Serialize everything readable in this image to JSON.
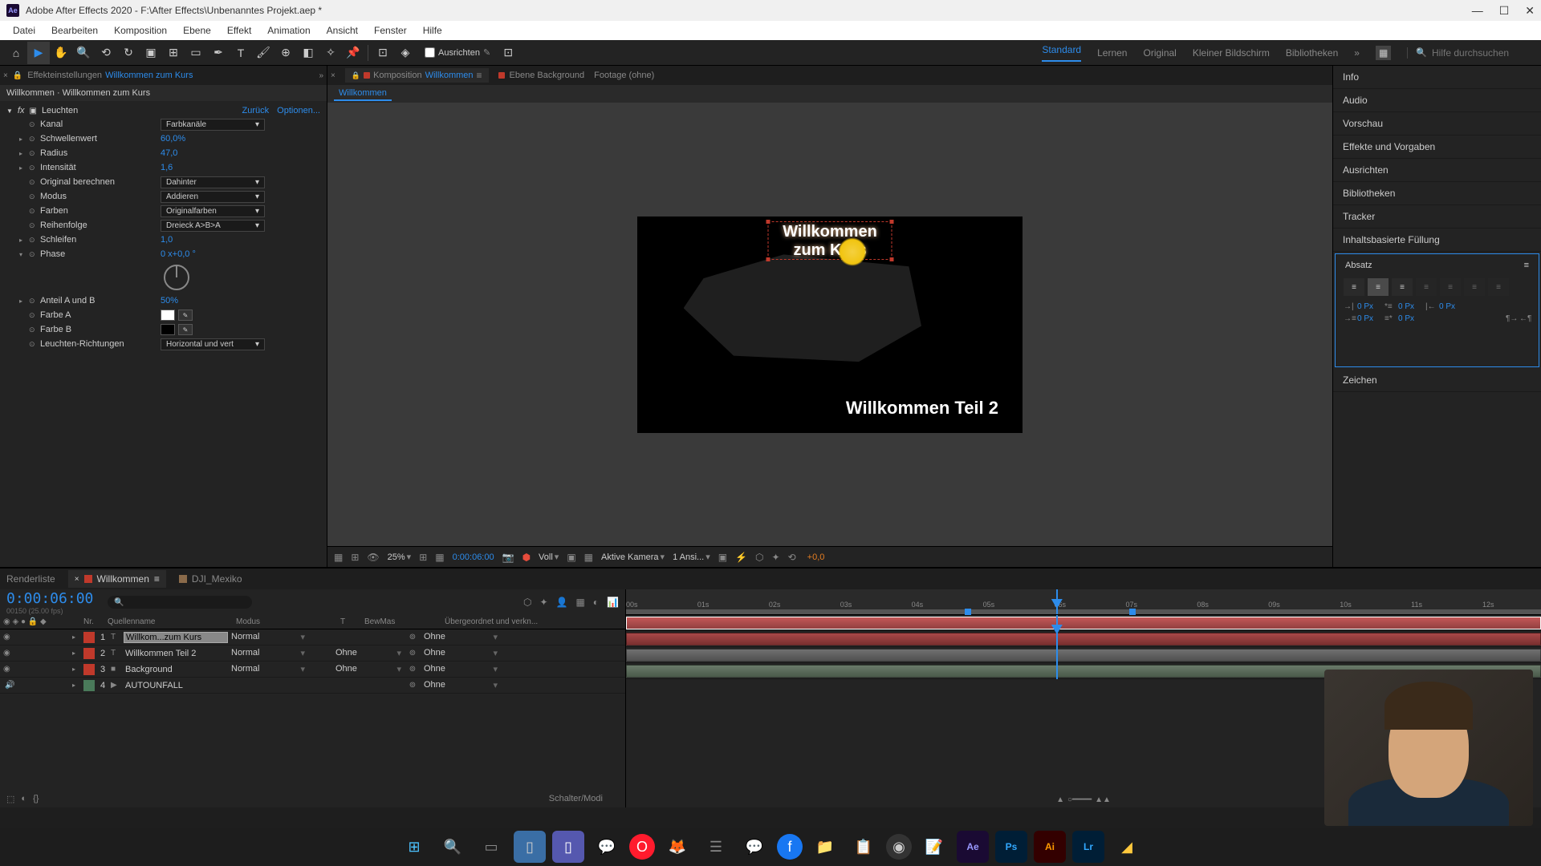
{
  "titlebar": {
    "app": "Ae",
    "title": "Adobe After Effects 2020 - F:\\After Effects\\Unbenanntes Projekt.aep *"
  },
  "menubar": [
    "Datei",
    "Bearbeiten",
    "Komposition",
    "Ebene",
    "Effekt",
    "Animation",
    "Ansicht",
    "Fenster",
    "Hilfe"
  ],
  "toolbar": {
    "align_label": "Ausrichten",
    "workspaces": [
      "Standard",
      "Lernen",
      "Original",
      "Kleiner Bildschirm",
      "Bibliotheken"
    ],
    "search_placeholder": "Hilfe durchsuchen"
  },
  "effect_panel": {
    "tab_prefix": "Effekteinstellungen",
    "tab_link": "Willkommen zum Kurs",
    "breadcrumb": "Willkommen · Willkommen zum Kurs",
    "effect_name": "Leuchten",
    "back": "Zurück",
    "options": "Optionen...",
    "props": {
      "kanal": {
        "label": "Kanal",
        "value": "Farbkanäle"
      },
      "schwellenwert": {
        "label": "Schwellenwert",
        "value": "60,0%"
      },
      "radius": {
        "label": "Radius",
        "value": "47,0"
      },
      "intensitaet": {
        "label": "Intensität",
        "value": "1,6"
      },
      "original": {
        "label": "Original berechnen",
        "value": "Dahinter"
      },
      "modus": {
        "label": "Modus",
        "value": "Addieren"
      },
      "farben": {
        "label": "Farben",
        "value": "Originalfarben"
      },
      "reihenfolge": {
        "label": "Reihenfolge",
        "value": "Dreieck A>B>A"
      },
      "schleifen": {
        "label": "Schleifen",
        "value": "1,0"
      },
      "phase": {
        "label": "Phase",
        "value": "0 x+0,0 °"
      },
      "anteil": {
        "label": "Anteil A und B",
        "value": "50%"
      },
      "farbe_a": {
        "label": "Farbe A"
      },
      "farbe_b": {
        "label": "Farbe B"
      },
      "richtungen": {
        "label": "Leuchten-Richtungen",
        "value": "Horizontal und vert"
      }
    }
  },
  "center": {
    "comp_tab_prefix": "Komposition",
    "comp_tab_link": "Willkommen",
    "layer_tab": "Ebene Background",
    "footage_tab": "Footage (ohne)",
    "nav": "Willkommen",
    "text1_line1": "Willkommen",
    "text1_line2": "zum Kurs",
    "text2": "Willkommen Teil 2",
    "controls": {
      "zoom": "25%",
      "timecode": "0:00:06:00",
      "res": "Voll",
      "camera": "Aktive Kamera",
      "views": "1 Ansi...",
      "exposure": "+0,0"
    }
  },
  "right_panels": [
    "Info",
    "Audio",
    "Vorschau",
    "Effekte und Vorgaben",
    "Ausrichten",
    "Bibliotheken",
    "Tracker",
    "Inhaltsbasierte Füllung"
  ],
  "absatz": {
    "title": "Absatz",
    "zeichen": "Zeichen",
    "px0": "0 Px",
    "plus0": "+0,0"
  },
  "timeline": {
    "tabs": {
      "render": "Renderliste",
      "comp": "Willkommen",
      "mexiko": "DJI_Mexiko"
    },
    "timecode": "0:00:06:00",
    "fps": "00150 (25.00 fps)",
    "headers": {
      "nr": "Nr.",
      "name": "Quellenname",
      "modus": "Modus",
      "t": "T",
      "trkmat": "BewMas",
      "parent": "Übergeordnet und verkn..."
    },
    "layers": [
      {
        "num": "1",
        "type": "T",
        "name": "Willkom...zum Kurs",
        "mode": "Normal",
        "trkmat": "",
        "parent": "Ohne",
        "color": "#c0392b",
        "selected": true
      },
      {
        "num": "2",
        "type": "T",
        "name": "Willkommen Teil 2",
        "mode": "Normal",
        "trkmat": "Ohne",
        "parent": "Ohne",
        "color": "#c0392b",
        "selected": false
      },
      {
        "num": "3",
        "type": "■",
        "name": "Background",
        "mode": "Normal",
        "trkmat": "Ohne",
        "parent": "Ohne",
        "color": "#c0392b",
        "selected": false
      },
      {
        "num": "4",
        "type": "▶",
        "name": "AUTOUNFALL",
        "mode": "",
        "trkmat": "",
        "parent": "Ohne",
        "color": "#4a7a5a",
        "selected": false
      }
    ],
    "footer": "Schalter/Modi",
    "ticks": [
      "00s",
      "01s",
      "02s",
      "03s",
      "04s",
      "05s",
      "06s",
      "07s",
      "08s",
      "09s",
      "10s",
      "11s",
      "12s"
    ]
  }
}
